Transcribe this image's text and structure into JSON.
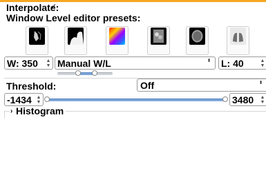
{
  "interpolate": {
    "label": "Interpolate:",
    "checked": true,
    "check_glyph": "✓"
  },
  "presets": {
    "title": "Window Level editor presets:",
    "items": [
      {
        "icon": "ct-chest-preset-icon"
      },
      {
        "icon": "ct-bone-preset-icon"
      },
      {
        "icon": "color-map-preset-icon"
      },
      {
        "icon": "ct-abdomen-preset-icon"
      },
      {
        "icon": "ct-brain-preset-icon"
      },
      {
        "icon": "ct-lung-preset-icon"
      }
    ]
  },
  "window_level": {
    "width_value": "W: 350",
    "mode_value": "Manual W/L",
    "level_value": "L: 40",
    "mode_dropdown_glyph": "⬍"
  },
  "threshold": {
    "label": "Threshold:",
    "mode_value": "Off",
    "mode_dropdown_glyph": "⬍",
    "min_value": "-1434",
    "max_value": "3480"
  },
  "histogram": {
    "label": "Histogram",
    "arrow": "›"
  },
  "colors": {
    "accent": "#f5a623"
  }
}
